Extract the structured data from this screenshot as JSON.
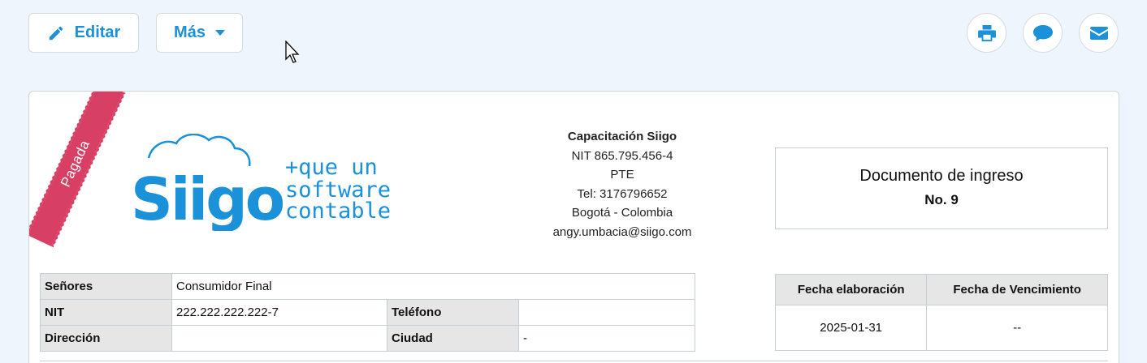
{
  "toolbar": {
    "edit_label": "Editar",
    "more_label": "Más"
  },
  "icons": {
    "edit": "pencil-icon",
    "more": "caret-down-icon",
    "print": "printer-icon",
    "comment": "comment-icon",
    "email": "envelope-icon"
  },
  "colors": {
    "accent": "#1a91d9",
    "ribbon": "#d83f64"
  },
  "status_ribbon": "Pagada",
  "logo": {
    "brand": "Siigo",
    "line1": "+que un",
    "line2": "software",
    "line3": "contable"
  },
  "company": {
    "name": "Capacitación Siigo",
    "nit": "NIT 865.795.456-4",
    "branch": "PTE",
    "phone": "Tel: 3176796652",
    "city": "Bogotá - Colombia",
    "email": "angy.umbacia@siigo.com"
  },
  "document": {
    "title": "Documento de ingreso",
    "number": "No. 9"
  },
  "client": {
    "senores_label": "Señores",
    "senores_value": "Consumidor Final",
    "nit_label": "NIT",
    "nit_value": "222.222.222.222-7",
    "telefono_label": "Teléfono",
    "telefono_value": "",
    "direccion_label": "Dirección",
    "direccion_value": "",
    "ciudad_label": "Ciudad",
    "ciudad_value": "-"
  },
  "dates": {
    "elaboracion_label": "Fecha elaboración",
    "vencimiento_label": "Fecha de Vencimiento",
    "elaboracion_value": "2025-01-31",
    "vencimiento_value": "--"
  }
}
